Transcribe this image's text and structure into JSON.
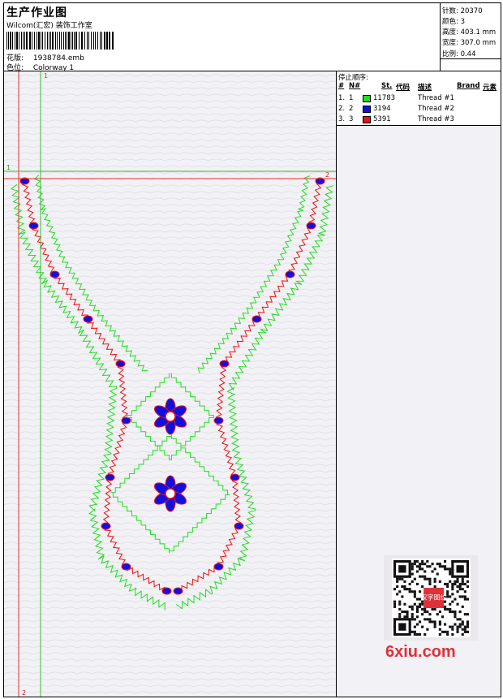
{
  "header": {
    "title": "生产作业图",
    "company": "Wilcom(汇宏) 装饰工作室",
    "design_label": "花版:",
    "design_value": "1938784.emb",
    "colorway_label": "色位:",
    "colorway_value": "Colorway 1"
  },
  "stats": {
    "stitches": "针数: 20370",
    "colors": "颜色: 3",
    "height": "高度: 403.1 mm",
    "width": "宽度: 307.0 mm",
    "ratio": "比例: 0.44"
  },
  "stop_sequence": {
    "label": "停止顺序:",
    "columns": [
      "#",
      "N#",
      "St.",
      "代码",
      "描述",
      "Brand",
      "元素"
    ],
    "rows": [
      {
        "idx": "1.",
        "n": "1",
        "color": "#22dd22",
        "st": "11783",
        "desc": "Thread #1"
      },
      {
        "idx": "2.",
        "n": "2",
        "color": "#1010e0",
        "st": "3194",
        "desc": "Thread #2"
      },
      {
        "idx": "3.",
        "n": "3",
        "color": "#ee1010",
        "st": "5391",
        "desc": "Thread #3"
      }
    ]
  },
  "guides": {
    "v1": "1",
    "v2": "2",
    "h1": "1",
    "h2": "2"
  },
  "watermark": {
    "text": "6xiu.com",
    "stamp": "汉字图纹"
  },
  "colors": {
    "green": "#22dd22",
    "blue": "#1010e0",
    "red": "#ee1010",
    "guide": "#e03030",
    "guide_green": "#30c030",
    "wm_red": "#e0303a"
  }
}
